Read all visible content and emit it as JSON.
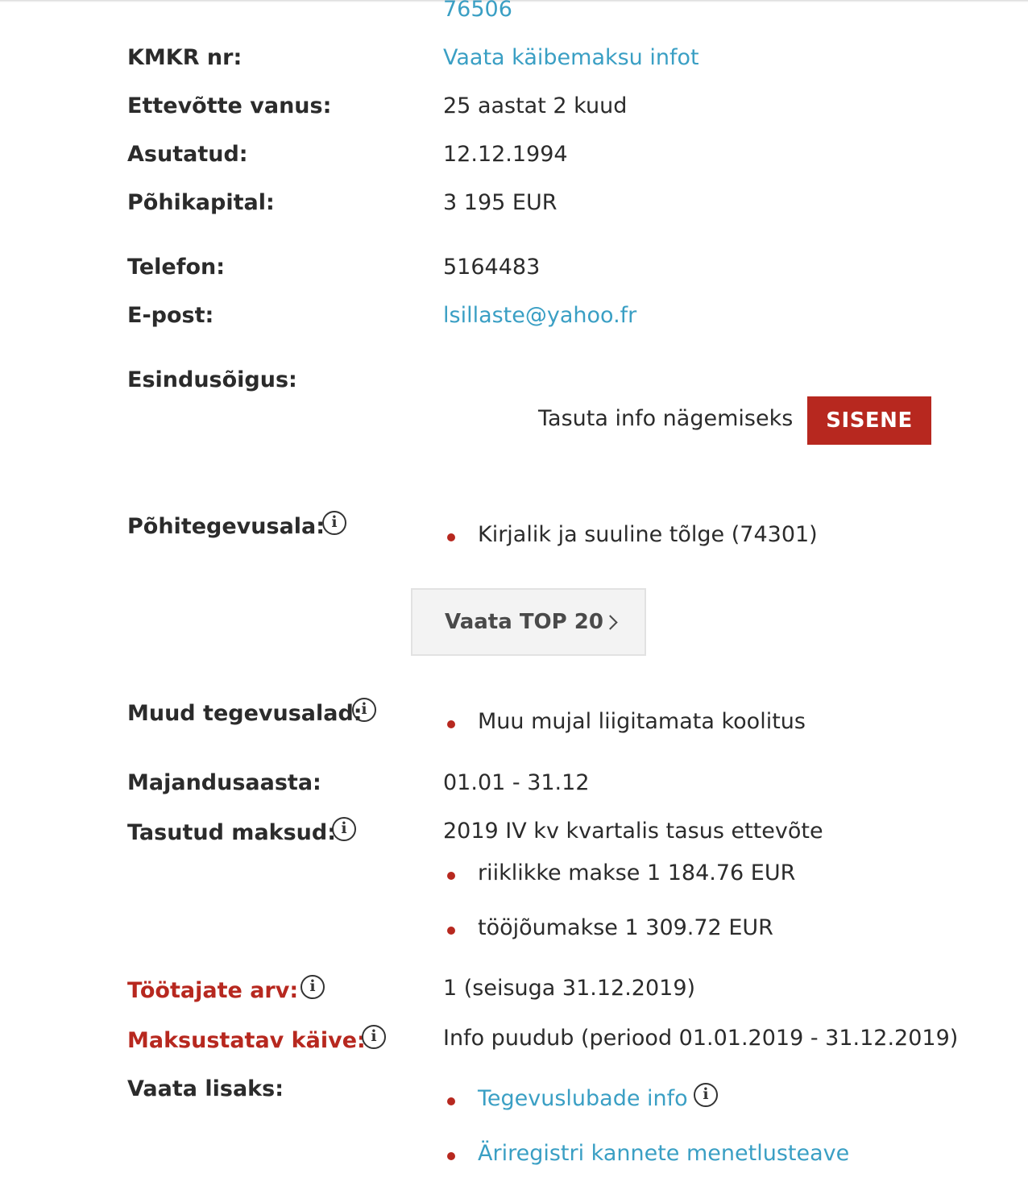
{
  "reg_code_partial": "76506",
  "rows": {
    "kmkr": {
      "label": "KMKR nr:",
      "value": "Vaata käibemaksu infot"
    },
    "vanus": {
      "label": "Ettevõtte vanus:",
      "value": "25 aastat 2 kuud"
    },
    "asutatud": {
      "label": "Asutatud:",
      "value": "12.12.1994"
    },
    "pohikapital": {
      "label": "Põhikapital:",
      "value": "3 195 EUR"
    },
    "telefon": {
      "label": "Telefon:",
      "value": "5164483"
    },
    "epost": {
      "label": "E-post:",
      "value": "lsillaste@yahoo.fr"
    },
    "esindusoigus": {
      "label": "Esindusõigus:"
    },
    "pohitegevusala": {
      "label": "Põhitegevusala:",
      "value": "Kirjalik ja suuline tõlge (74301)"
    },
    "muud": {
      "label": "Muud tegevusalad:",
      "value": "Muu mujal liigitamata koolitus"
    },
    "majandusaasta": {
      "label": "Majandusaasta:",
      "value": "01.01 - 31.12"
    },
    "maksud": {
      "label": "Tasutud maksud:",
      "intro": "2019 IV kv kvartalis tasus ettevõte",
      "items": [
        "riiklikke makse 1 184.76 EUR",
        "tööjõumakse 1 309.72 EUR"
      ]
    },
    "tootajad": {
      "label": "Töötajate arv:",
      "value": "1 (seisuga 31.12.2019)"
    },
    "kaive": {
      "label": "Maksustatav käive:",
      "value": "Info puudub (periood 01.01.2019 - 31.12.2019)"
    },
    "lisaks": {
      "label": "Vaata lisaks:",
      "links": [
        "Tegevuslubade info",
        "Äriregistri kannete menetlusteave"
      ]
    }
  },
  "login_prompt": {
    "text": "Tasuta info nägemiseks",
    "button": "SISENE"
  },
  "top20_button": "Vaata TOP 20",
  "colors": {
    "accent_red": "#b7281f",
    "link_blue": "#3a9fc4"
  },
  "icons": {
    "info": "info-circle-icon",
    "chevron": "chevron-right-icon"
  }
}
